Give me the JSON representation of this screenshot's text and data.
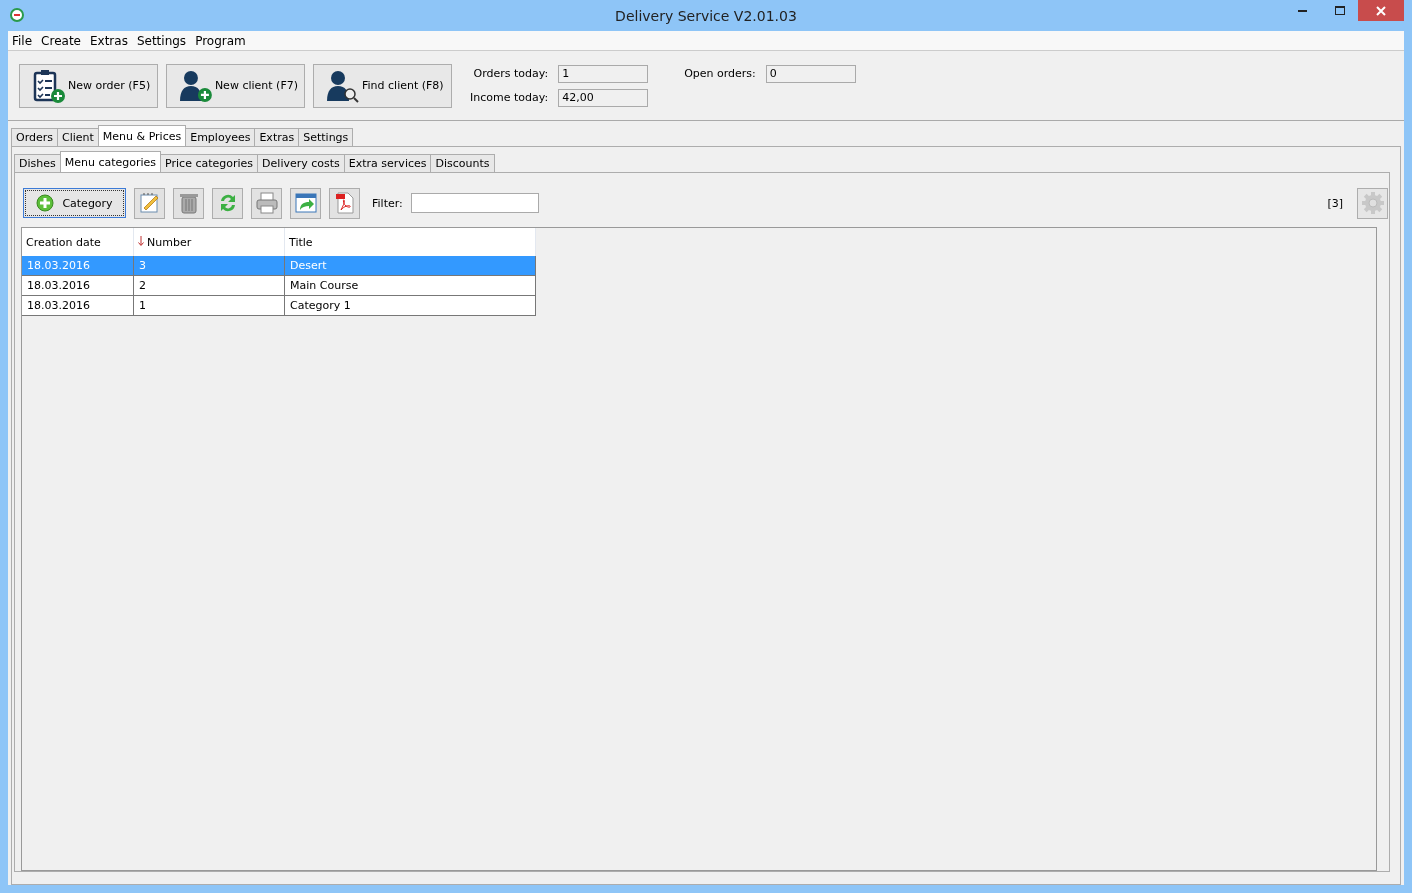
{
  "window": {
    "title": "Delivery Service V2.01.03"
  },
  "menu": [
    "File",
    "Create",
    "Extras",
    "Settings",
    "Program"
  ],
  "action_buttons": [
    {
      "kind": "order",
      "label": "New order (F5)"
    },
    {
      "kind": "new-client",
      "label": "New client (F7)"
    },
    {
      "kind": "find-client",
      "label": "Find client (F8)"
    }
  ],
  "stats": [
    {
      "label": "Orders today:",
      "value": "1"
    },
    {
      "label": "Income today:",
      "value": "42,00"
    },
    {
      "label": "Open orders:",
      "value": "0"
    }
  ],
  "tabs": [
    {
      "label": "Orders",
      "selected": false
    },
    {
      "label": "Client",
      "selected": false
    },
    {
      "label": "Menu & Prices",
      "selected": true
    },
    {
      "label": "Employees",
      "selected": false
    },
    {
      "label": "Extras",
      "selected": false
    },
    {
      "label": "Settings",
      "selected": false
    }
  ],
  "subtabs": [
    {
      "label": "Dishes",
      "selected": false
    },
    {
      "label": "Menu categories",
      "selected": true
    },
    {
      "label": "Price categories",
      "selected": false
    },
    {
      "label": "Delivery costs",
      "selected": false
    },
    {
      "label": "Extra services",
      "selected": false
    },
    {
      "label": "Discounts",
      "selected": false
    }
  ],
  "toolbar": {
    "add_button": "Category",
    "filter": {
      "label": "Filter:"
    },
    "count": "[3]"
  },
  "table": {
    "columns": [
      {
        "label": "Creation date",
        "sorted": false
      },
      {
        "label": "Number",
        "sorted": true
      },
      {
        "label": "Title",
        "sorted": false
      }
    ],
    "rows": [
      {
        "cells": [
          "18.03.2016",
          "3",
          "Desert"
        ],
        "selected": true
      },
      {
        "cells": [
          "18.03.2016",
          "2",
          "Main Course"
        ],
        "selected": false
      },
      {
        "cells": [
          "18.03.2016",
          "1",
          "Category 1"
        ],
        "selected": false
      }
    ]
  }
}
